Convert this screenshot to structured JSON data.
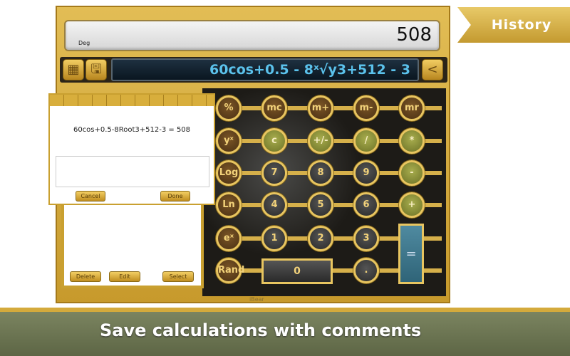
{
  "display": {
    "mode": "Deg",
    "result": "508"
  },
  "toolbar": {
    "expression": "60cos+0.5 - 8ˣ√y3+512 - 3",
    "back_label": "<"
  },
  "keys": [
    {
      "label": "%",
      "kind": "fn"
    },
    {
      "label": "mc",
      "kind": "fn"
    },
    {
      "label": "m+",
      "kind": "fn"
    },
    {
      "label": "m-",
      "kind": "fn"
    },
    {
      "label": "mr",
      "kind": "fn"
    },
    {
      "label": "yˣ",
      "kind": "fn"
    },
    {
      "label": "c",
      "kind": "op"
    },
    {
      "label": "+/-",
      "kind": "op"
    },
    {
      "label": "/",
      "kind": "op"
    },
    {
      "label": "*",
      "kind": "op"
    },
    {
      "label": "Log",
      "kind": "fn"
    },
    {
      "label": "7",
      "kind": "num"
    },
    {
      "label": "8",
      "kind": "num"
    },
    {
      "label": "9",
      "kind": "num"
    },
    {
      "label": "-",
      "kind": "op"
    },
    {
      "label": "Ln",
      "kind": "fn"
    },
    {
      "label": "4",
      "kind": "num"
    },
    {
      "label": "5",
      "kind": "num"
    },
    {
      "label": "6",
      "kind": "num"
    },
    {
      "label": "+",
      "kind": "op"
    },
    {
      "label": "eˣ",
      "kind": "fn"
    },
    {
      "label": "1",
      "kind": "num"
    },
    {
      "label": "2",
      "kind": "num"
    },
    {
      "label": "3",
      "kind": "num"
    },
    null,
    {
      "label": "Rand",
      "kind": "fn"
    },
    null,
    null,
    {
      "label": ".",
      "kind": "num"
    },
    null
  ],
  "zero_label": "0",
  "equals_label": "=",
  "brand": "iBear",
  "dialog": {
    "text": "60cos+0.5-8Root3+512-3 = 508",
    "comment_value": "",
    "cancel": "Cancel",
    "done": "Done"
  },
  "history_panel": {
    "delete": "Delete",
    "edit": "Edit",
    "select": "Select"
  },
  "history_tab": "History",
  "caption": "Save calculations with comments"
}
